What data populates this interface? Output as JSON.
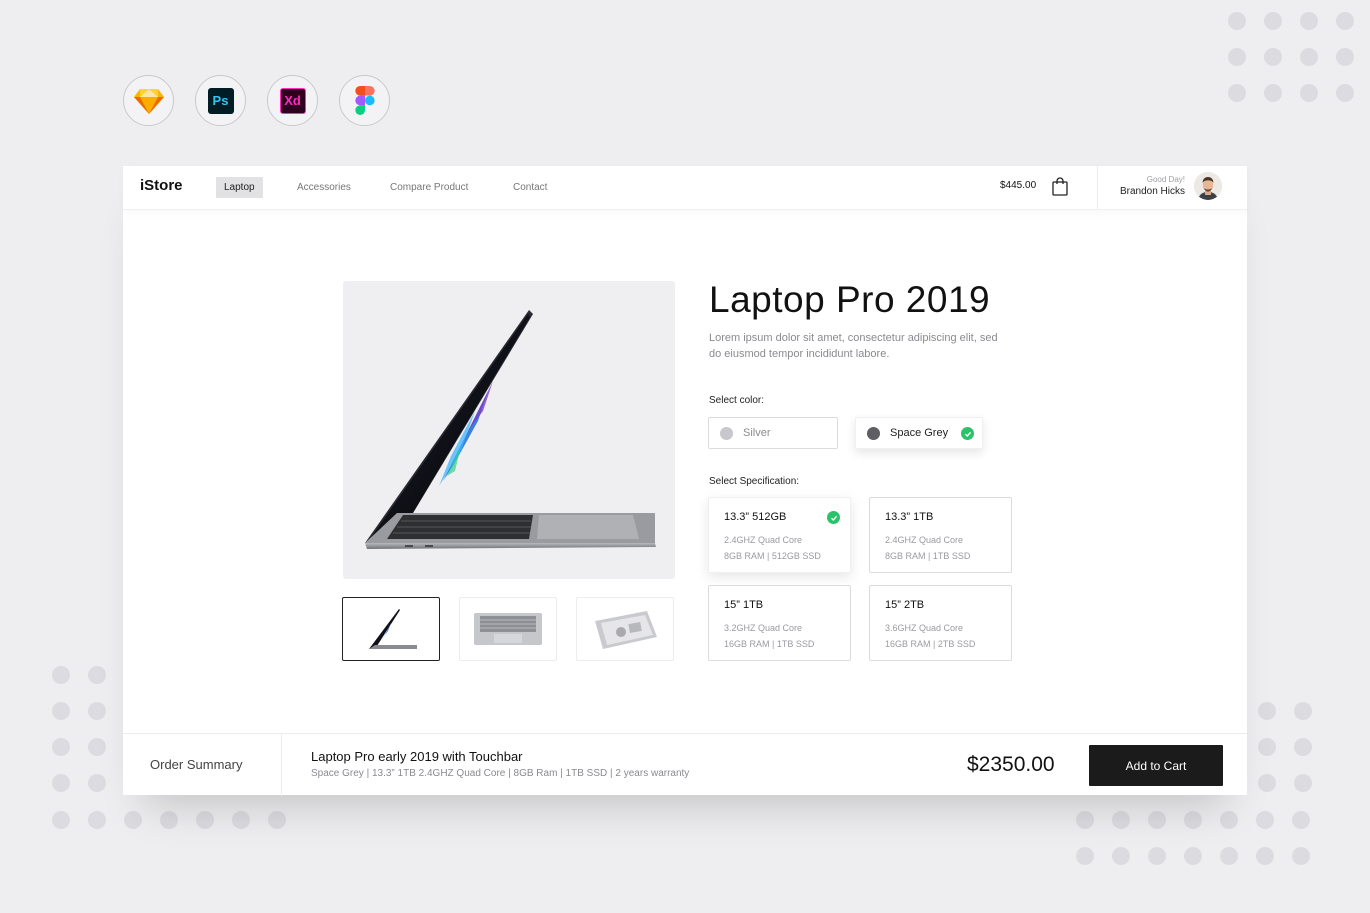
{
  "tools": [
    {
      "name": "sketch-icon"
    },
    {
      "name": "photoshop-icon",
      "text": "Ps",
      "color": "#31c5f0",
      "bg": "#001d26"
    },
    {
      "name": "xd-icon",
      "text": "Xd",
      "color": "#ff2bc2",
      "bg": "#2e001f"
    },
    {
      "name": "figma-icon"
    }
  ],
  "nav": {
    "brand": "iStore",
    "links": [
      "Laptop",
      "Accessories",
      "Compare Product",
      "Contact"
    ],
    "cart_total": "$445.00",
    "greeting": "Good Day!",
    "user_name": "Brandon Hicks"
  },
  "product": {
    "title": "Laptop Pro 2019",
    "description": "Lorem ipsum dolor sit amet, consectetur adipiscing elit, sed do eiusmod tempor incididunt labore."
  },
  "color": {
    "label": "Select color:",
    "options": [
      {
        "name": "Silver",
        "swatch": "#c8c8cc",
        "selected": false
      },
      {
        "name": "Space Grey",
        "swatch": "#5e5e63",
        "selected": true
      }
    ]
  },
  "spec": {
    "label": "Select Specification:",
    "options": [
      {
        "title": "13.3” 512GB",
        "cpu": "2.4GHZ Quad Core",
        "mem": "8GB RAM | 512GB SSD",
        "selected": true
      },
      {
        "title": "13.3” 1TB",
        "cpu": "2.4GHZ Quad Core",
        "mem": "8GB RAM | 1TB SSD",
        "selected": false
      },
      {
        "title": "15” 1TB",
        "cpu": "3.2GHZ Quad Core",
        "mem": "16GB RAM | 1TB SSD",
        "selected": false
      },
      {
        "title": "15” 2TB",
        "cpu": "3.6GHZ Quad Core",
        "mem": "16GB RAM | 2TB SSD",
        "selected": false
      }
    ]
  },
  "summary": {
    "label": "Order Summary",
    "title": "Laptop Pro early 2019 with Touchbar",
    "detail": "Space Grey | 13.3” 1TB 2.4GHZ Quad Core | 8GB Ram | 1TB SSD | 2 years warranty",
    "price": "$2350.00",
    "button": "Add to Cart"
  },
  "colors": {
    "accent": "#1b1b1b",
    "check": "#2bc26a",
    "active_nav": "#e2e2e5"
  }
}
